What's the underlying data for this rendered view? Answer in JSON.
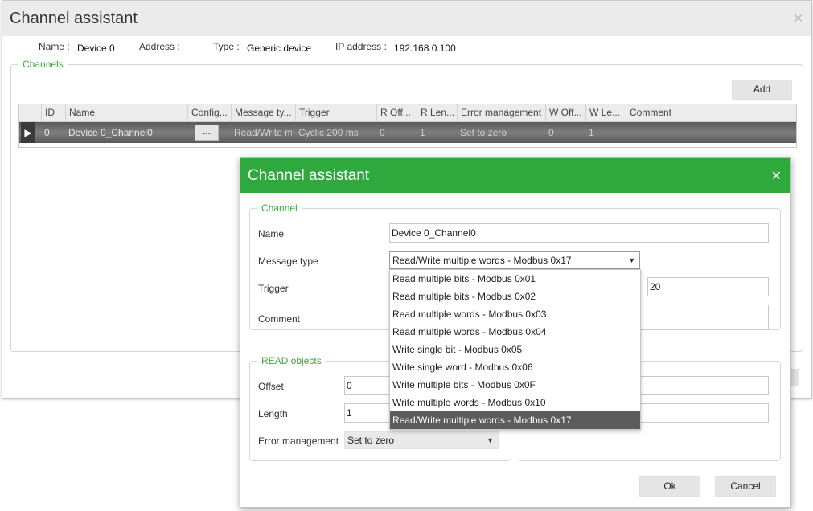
{
  "outer_dialog": {
    "title": "Channel assistant",
    "close_glyph": "✕",
    "info": {
      "name_label": "Name :",
      "name_value": "Device 0",
      "address_label": "Address :",
      "type_label": "Type :",
      "type_value": "Generic device",
      "ip_label": "IP address :",
      "ip_value": "192.168.0.100"
    },
    "channels_group_title": "Channels",
    "add_button": "Add",
    "grid": {
      "columns": [
        "ID",
        "Name",
        "Config...",
        "Message ty...",
        "Trigger",
        "R Off...",
        "R Len...",
        "Error management",
        "W Off...",
        "W Le...",
        "Comment"
      ],
      "rows": [
        {
          "id": "0",
          "name": "Device 0_Channel0",
          "config_button": "...",
          "message_type": "Read/Write mu",
          "trigger": "Cyclic 200 ms",
          "r_offset": "0",
          "r_length": "1",
          "error_management": "Set to zero",
          "w_offset": "0",
          "w_length": "1",
          "comment": ""
        }
      ]
    }
  },
  "inner_dialog": {
    "title": "Channel assistant",
    "close_glyph": "✕",
    "channel_group_title": "Channel",
    "name_label": "Name",
    "name_value": "Device 0_Channel0",
    "message_type_label": "Message type",
    "message_type_value": "Read/Write multiple words - Modbus 0x17",
    "message_type_options": [
      "Read multiple bits - Modbus 0x01",
      "Read multiple bits - Modbus 0x02",
      "Read multiple words - Modbus 0x03",
      "Read multiple words - Modbus 0x04",
      "Write single bit - Modbus 0x05",
      "Write single word - Modbus 0x06",
      "Write multiple bits - Modbus 0x0F",
      "Write multiple words - Modbus 0x10",
      "Read/Write multiple words - Modbus 0x17"
    ],
    "selected_option_index": 8,
    "trigger_label": "Trigger",
    "trigger_value": "20",
    "comment_label": "Comment",
    "comment_value": "",
    "read_group_title": "READ objects",
    "offset_label": "Offset",
    "offset_value": "0",
    "length_label": "Length",
    "length_value": "1",
    "error_label": "Error management",
    "error_value": "Set to zero",
    "ok_button": "Ok",
    "cancel_button": "Cancel"
  },
  "colors": {
    "accent_green": "#2fa83d",
    "group_title_green": "#3aa83a",
    "selected_row": "#5c5c5c"
  }
}
